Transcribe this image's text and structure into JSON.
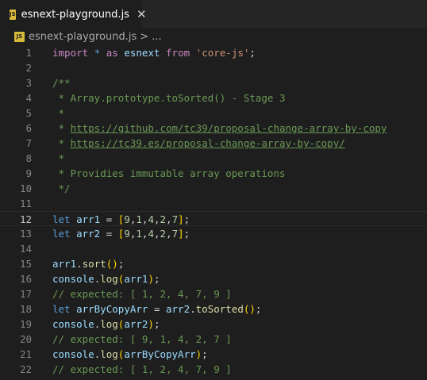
{
  "tab": {
    "title": "esnext-playground.js",
    "icon": "JS",
    "close": "✕"
  },
  "breadcrumb": {
    "file": "esnext-playground.js",
    "separator": ">",
    "more": "..."
  },
  "editor": {
    "current_line": 12,
    "lines": [
      {
        "n": "1",
        "parts": [
          {
            "c": "ctl",
            "t": "import"
          },
          {
            "c": "pun",
            "t": " "
          },
          {
            "c": "kw",
            "t": "*"
          },
          {
            "c": "pun",
            "t": " "
          },
          {
            "c": "ctl",
            "t": "as"
          },
          {
            "c": "pun",
            "t": " "
          },
          {
            "c": "var",
            "t": "esnext"
          },
          {
            "c": "pun",
            "t": " "
          },
          {
            "c": "ctl",
            "t": "from"
          },
          {
            "c": "pun",
            "t": " "
          },
          {
            "c": "str",
            "t": "'core-js'"
          },
          {
            "c": "pun",
            "t": ";"
          }
        ]
      },
      {
        "n": "2",
        "parts": []
      },
      {
        "n": "3",
        "parts": [
          {
            "c": "cmt",
            "t": "/**"
          }
        ]
      },
      {
        "n": "4",
        "parts": [
          {
            "c": "cmt",
            "t": " * Array.prototype.toSorted() - Stage 3"
          }
        ]
      },
      {
        "n": "5",
        "parts": [
          {
            "c": "cmt",
            "t": " *"
          }
        ]
      },
      {
        "n": "6",
        "parts": [
          {
            "c": "cmt",
            "t": " * "
          },
          {
            "c": "link",
            "t": "https://github.com/tc39/proposal-change-array-by-copy"
          }
        ]
      },
      {
        "n": "7",
        "parts": [
          {
            "c": "cmt",
            "t": " * "
          },
          {
            "c": "link",
            "t": "https://tc39.es/proposal-change-array-by-copy/"
          }
        ]
      },
      {
        "n": "8",
        "parts": [
          {
            "c": "cmt",
            "t": " *"
          }
        ]
      },
      {
        "n": "9",
        "parts": [
          {
            "c": "cmt",
            "t": " * Providies immutable array operations"
          }
        ]
      },
      {
        "n": "10",
        "parts": [
          {
            "c": "cmt",
            "t": " */"
          }
        ]
      },
      {
        "n": "11",
        "parts": []
      },
      {
        "n": "12",
        "parts": [
          {
            "c": "kw",
            "t": "let"
          },
          {
            "c": "pun",
            "t": " "
          },
          {
            "c": "var",
            "t": "arr1"
          },
          {
            "c": "pun",
            "t": " = "
          },
          {
            "c": "brk",
            "t": "["
          },
          {
            "c": "num",
            "t": "9"
          },
          {
            "c": "pun",
            "t": ","
          },
          {
            "c": "num",
            "t": "1"
          },
          {
            "c": "pun",
            "t": ","
          },
          {
            "c": "num",
            "t": "4"
          },
          {
            "c": "pun",
            "t": ","
          },
          {
            "c": "num",
            "t": "2"
          },
          {
            "c": "pun",
            "t": ","
          },
          {
            "c": "num",
            "t": "7"
          },
          {
            "c": "brk",
            "t": "]"
          },
          {
            "c": "pun",
            "t": ";"
          }
        ]
      },
      {
        "n": "13",
        "parts": [
          {
            "c": "kw",
            "t": "let"
          },
          {
            "c": "pun",
            "t": " "
          },
          {
            "c": "var",
            "t": "arr2"
          },
          {
            "c": "pun",
            "t": " = "
          },
          {
            "c": "brk",
            "t": "["
          },
          {
            "c": "num",
            "t": "9"
          },
          {
            "c": "pun",
            "t": ","
          },
          {
            "c": "num",
            "t": "1"
          },
          {
            "c": "pun",
            "t": ","
          },
          {
            "c": "num",
            "t": "4"
          },
          {
            "c": "pun",
            "t": ","
          },
          {
            "c": "num",
            "t": "2"
          },
          {
            "c": "pun",
            "t": ","
          },
          {
            "c": "num",
            "t": "7"
          },
          {
            "c": "brk",
            "t": "]"
          },
          {
            "c": "pun",
            "t": ";"
          }
        ]
      },
      {
        "n": "14",
        "parts": []
      },
      {
        "n": "15",
        "parts": [
          {
            "c": "var",
            "t": "arr1"
          },
          {
            "c": "pun",
            "t": "."
          },
          {
            "c": "fn",
            "t": "sort"
          },
          {
            "c": "brk",
            "t": "()"
          },
          {
            "c": "pun",
            "t": ";"
          }
        ]
      },
      {
        "n": "16",
        "parts": [
          {
            "c": "var",
            "t": "console"
          },
          {
            "c": "pun",
            "t": "."
          },
          {
            "c": "fn",
            "t": "log"
          },
          {
            "c": "brk",
            "t": "("
          },
          {
            "c": "var",
            "t": "arr1"
          },
          {
            "c": "brk",
            "t": ")"
          },
          {
            "c": "pun",
            "t": ";"
          }
        ]
      },
      {
        "n": "17",
        "parts": [
          {
            "c": "cmt",
            "t": "// expected: [ 1, 2, 4, 7, 9 ]"
          }
        ]
      },
      {
        "n": "18",
        "parts": [
          {
            "c": "kw",
            "t": "let"
          },
          {
            "c": "pun",
            "t": " "
          },
          {
            "c": "var",
            "t": "arrByCopyArr"
          },
          {
            "c": "pun",
            "t": " = "
          },
          {
            "c": "var",
            "t": "arr2"
          },
          {
            "c": "pun",
            "t": "."
          },
          {
            "c": "fn",
            "t": "toSorted"
          },
          {
            "c": "brk",
            "t": "()"
          },
          {
            "c": "pun",
            "t": ";"
          }
        ]
      },
      {
        "n": "19",
        "parts": [
          {
            "c": "var",
            "t": "console"
          },
          {
            "c": "pun",
            "t": "."
          },
          {
            "c": "fn",
            "t": "log"
          },
          {
            "c": "brk",
            "t": "("
          },
          {
            "c": "var",
            "t": "arr2"
          },
          {
            "c": "brk",
            "t": ")"
          },
          {
            "c": "pun",
            "t": ";"
          }
        ]
      },
      {
        "n": "20",
        "parts": [
          {
            "c": "cmt",
            "t": "// expected: [ 9, 1, 4, 2, 7 ]"
          }
        ]
      },
      {
        "n": "21",
        "parts": [
          {
            "c": "var",
            "t": "console"
          },
          {
            "c": "pun",
            "t": "."
          },
          {
            "c": "fn",
            "t": "log"
          },
          {
            "c": "brk",
            "t": "("
          },
          {
            "c": "var",
            "t": "arrByCopyArr"
          },
          {
            "c": "brk",
            "t": ")"
          },
          {
            "c": "pun",
            "t": ";"
          }
        ]
      },
      {
        "n": "22",
        "parts": [
          {
            "c": "cmt",
            "t": "// expected: [ 1, 2, 4, 7, 9 ]"
          }
        ]
      }
    ]
  }
}
